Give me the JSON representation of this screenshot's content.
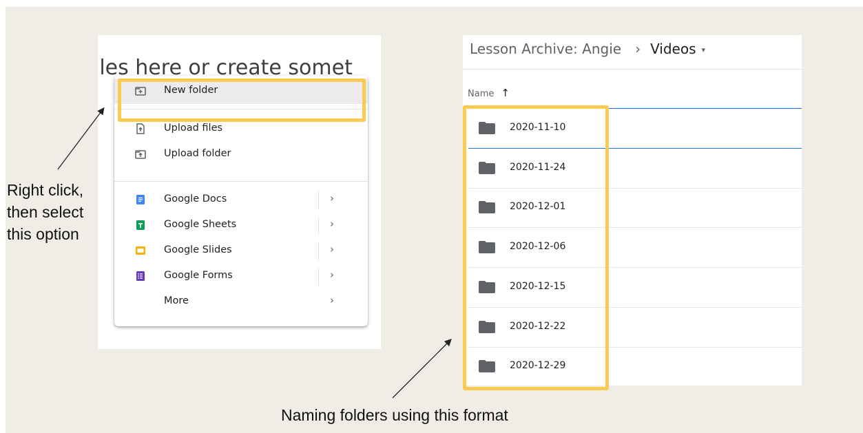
{
  "colors": {
    "highlight": "#f9cb55",
    "slide_bg": "#efede6",
    "selection": "#1a73e8",
    "docs": "#4285f4",
    "sheets": "#0f9d58",
    "slides": "#f4b400",
    "forms": "#673ab7"
  },
  "left_panel": {
    "bg_heading": "iles here or create somet",
    "menu": {
      "new_folder": {
        "label": "New folder",
        "icon": "new-folder-icon"
      },
      "upload_files": {
        "label": "Upload files",
        "icon": "upload-file-icon"
      },
      "upload_folder": {
        "label": "Upload folder",
        "icon": "upload-folder-icon"
      },
      "google_docs": {
        "label": "Google Docs",
        "icon": "google-docs-icon",
        "chevron": "›"
      },
      "google_sheets": {
        "label": "Google Sheets",
        "icon": "google-sheets-icon",
        "chevron": "›"
      },
      "google_slides": {
        "label": "Google Slides",
        "icon": "google-slides-icon",
        "chevron": "›"
      },
      "google_forms": {
        "label": "Google Forms",
        "icon": "google-forms-icon",
        "chevron": "›"
      },
      "more": {
        "label": "More",
        "chevron": "›"
      }
    }
  },
  "annotation_left": [
    "Right click,",
    "then select",
    "this option"
  ],
  "right_panel": {
    "breadcrumb": {
      "parent": "Lesson Archive: Angie",
      "separator": "›",
      "current": "Videos",
      "dropdown": "▾"
    },
    "column_header": {
      "label": "Name",
      "sort_arrow": "↑"
    },
    "folders": [
      "2020-11-10",
      "2020-11-24",
      "2020-12-01",
      "2020-12-06",
      "2020-12-15",
      "2020-12-22",
      "2020-12-29"
    ]
  },
  "annotation_bottom": "Naming folders using this format"
}
